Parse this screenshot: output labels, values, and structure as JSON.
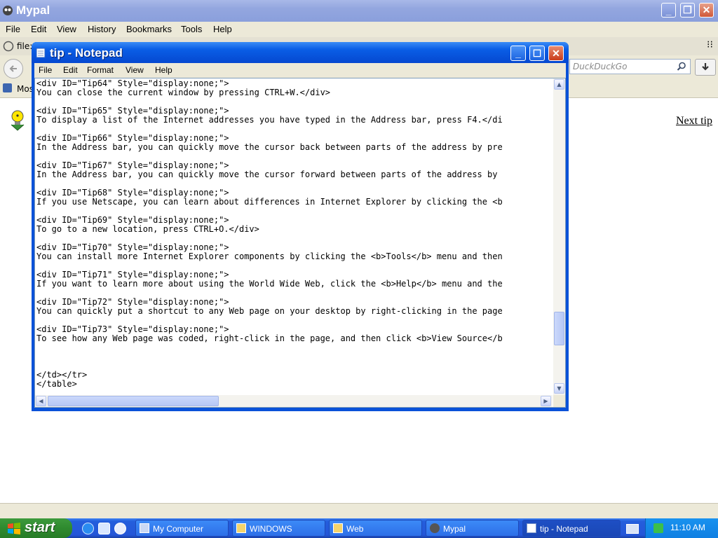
{
  "browser": {
    "title": "Mypal",
    "menu": [
      "File",
      "Edit",
      "View",
      "History",
      "Bookmarks",
      "Tools",
      "Help"
    ],
    "tab_label": "file:",
    "search_placeholder": "DuckDuckGo",
    "bookmarks_label": "Mos",
    "next_tip": "Next tip"
  },
  "notepad": {
    "title": "tip - Notepad",
    "menu": [
      "File",
      "Edit",
      "Format",
      "View",
      "Help"
    ],
    "lines": [
      "<div ID=\"Tip64\" Style=\"display:none;\">",
      "You can close the current window by pressing CTRL+W.</div>",
      "",
      "<div ID=\"Tip65\" Style=\"display:none;\">",
      "To display a list of the Internet addresses you have typed in the Address bar, press F4.</di",
      "",
      "<div ID=\"Tip66\" Style=\"display:none;\">",
      "In the Address bar, you can quickly move the cursor back between parts of the address by pre",
      "",
      "<div ID=\"Tip67\" Style=\"display:none;\">",
      "In the Address bar, you can quickly move the cursor forward between parts of the address by",
      "",
      "<div ID=\"Tip68\" Style=\"display:none;\">",
      "If you use Netscape, you can learn about differences in Internet Explorer by clicking the <b",
      "",
      "<div ID=\"Tip69\" Style=\"display:none;\">",
      "To go to a new location, press CTRL+O.</div>",
      "",
      "<div ID=\"Tip70\" Style=\"display:none;\">",
      "You can install more Internet Explorer components by clicking the <b>Tools</b> menu and then",
      "",
      "<div ID=\"Tip71\" Style=\"display:none;\">",
      "If you want to learn more about using the World Wide Web, click the <b>Help</b> menu and the",
      "",
      "<div ID=\"Tip72\" Style=\"display:none;\">",
      "You can quickly put a shortcut to any Web page on your desktop by right-clicking in the page",
      "",
      "<div ID=\"Tip73\" Style=\"display:none;\">",
      "To see how any Web page was coded, right-click in the page, and then click <b>View Source</b",
      "",
      "",
      "",
      "</td></tr>",
      "</table>"
    ]
  },
  "taskbar": {
    "start": "start",
    "tasks": [
      "My Computer",
      "WINDOWS",
      "Web",
      "Mypal",
      "tip - Notepad"
    ],
    "clock": "11:10 AM"
  },
  "colors": {
    "xp_blue": "#0a52d8",
    "start_green": "#2f8a2f"
  }
}
